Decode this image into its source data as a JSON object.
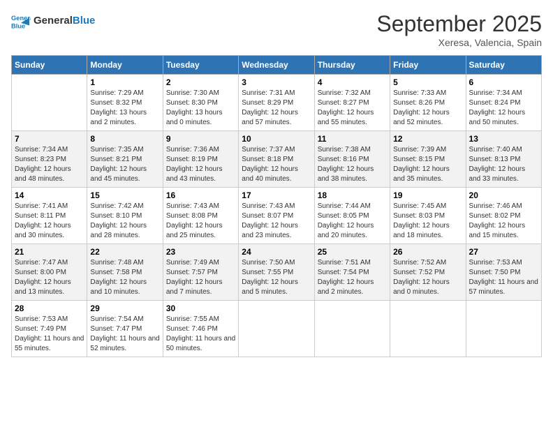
{
  "header": {
    "logo_line1": "General",
    "logo_line2": "Blue",
    "month_title": "September 2025",
    "subtitle": "Xeresa, Valencia, Spain"
  },
  "days_of_week": [
    "Sunday",
    "Monday",
    "Tuesday",
    "Wednesday",
    "Thursday",
    "Friday",
    "Saturday"
  ],
  "weeks": [
    [
      {
        "day": "",
        "sunrise": "",
        "sunset": "",
        "daylight": ""
      },
      {
        "day": "1",
        "sunrise": "Sunrise: 7:29 AM",
        "sunset": "Sunset: 8:32 PM",
        "daylight": "Daylight: 13 hours and 2 minutes."
      },
      {
        "day": "2",
        "sunrise": "Sunrise: 7:30 AM",
        "sunset": "Sunset: 8:30 PM",
        "daylight": "Daylight: 13 hours and 0 minutes."
      },
      {
        "day": "3",
        "sunrise": "Sunrise: 7:31 AM",
        "sunset": "Sunset: 8:29 PM",
        "daylight": "Daylight: 12 hours and 57 minutes."
      },
      {
        "day": "4",
        "sunrise": "Sunrise: 7:32 AM",
        "sunset": "Sunset: 8:27 PM",
        "daylight": "Daylight: 12 hours and 55 minutes."
      },
      {
        "day": "5",
        "sunrise": "Sunrise: 7:33 AM",
        "sunset": "Sunset: 8:26 PM",
        "daylight": "Daylight: 12 hours and 52 minutes."
      },
      {
        "day": "6",
        "sunrise": "Sunrise: 7:34 AM",
        "sunset": "Sunset: 8:24 PM",
        "daylight": "Daylight: 12 hours and 50 minutes."
      }
    ],
    [
      {
        "day": "7",
        "sunrise": "Sunrise: 7:34 AM",
        "sunset": "Sunset: 8:23 PM",
        "daylight": "Daylight: 12 hours and 48 minutes."
      },
      {
        "day": "8",
        "sunrise": "Sunrise: 7:35 AM",
        "sunset": "Sunset: 8:21 PM",
        "daylight": "Daylight: 12 hours and 45 minutes."
      },
      {
        "day": "9",
        "sunrise": "Sunrise: 7:36 AM",
        "sunset": "Sunset: 8:19 PM",
        "daylight": "Daylight: 12 hours and 43 minutes."
      },
      {
        "day": "10",
        "sunrise": "Sunrise: 7:37 AM",
        "sunset": "Sunset: 8:18 PM",
        "daylight": "Daylight: 12 hours and 40 minutes."
      },
      {
        "day": "11",
        "sunrise": "Sunrise: 7:38 AM",
        "sunset": "Sunset: 8:16 PM",
        "daylight": "Daylight: 12 hours and 38 minutes."
      },
      {
        "day": "12",
        "sunrise": "Sunrise: 7:39 AM",
        "sunset": "Sunset: 8:15 PM",
        "daylight": "Daylight: 12 hours and 35 minutes."
      },
      {
        "day": "13",
        "sunrise": "Sunrise: 7:40 AM",
        "sunset": "Sunset: 8:13 PM",
        "daylight": "Daylight: 12 hours and 33 minutes."
      }
    ],
    [
      {
        "day": "14",
        "sunrise": "Sunrise: 7:41 AM",
        "sunset": "Sunset: 8:11 PM",
        "daylight": "Daylight: 12 hours and 30 minutes."
      },
      {
        "day": "15",
        "sunrise": "Sunrise: 7:42 AM",
        "sunset": "Sunset: 8:10 PM",
        "daylight": "Daylight: 12 hours and 28 minutes."
      },
      {
        "day": "16",
        "sunrise": "Sunrise: 7:43 AM",
        "sunset": "Sunset: 8:08 PM",
        "daylight": "Daylight: 12 hours and 25 minutes."
      },
      {
        "day": "17",
        "sunrise": "Sunrise: 7:43 AM",
        "sunset": "Sunset: 8:07 PM",
        "daylight": "Daylight: 12 hours and 23 minutes."
      },
      {
        "day": "18",
        "sunrise": "Sunrise: 7:44 AM",
        "sunset": "Sunset: 8:05 PM",
        "daylight": "Daylight: 12 hours and 20 minutes."
      },
      {
        "day": "19",
        "sunrise": "Sunrise: 7:45 AM",
        "sunset": "Sunset: 8:03 PM",
        "daylight": "Daylight: 12 hours and 18 minutes."
      },
      {
        "day": "20",
        "sunrise": "Sunrise: 7:46 AM",
        "sunset": "Sunset: 8:02 PM",
        "daylight": "Daylight: 12 hours and 15 minutes."
      }
    ],
    [
      {
        "day": "21",
        "sunrise": "Sunrise: 7:47 AM",
        "sunset": "Sunset: 8:00 PM",
        "daylight": "Daylight: 12 hours and 13 minutes."
      },
      {
        "day": "22",
        "sunrise": "Sunrise: 7:48 AM",
        "sunset": "Sunset: 7:58 PM",
        "daylight": "Daylight: 12 hours and 10 minutes."
      },
      {
        "day": "23",
        "sunrise": "Sunrise: 7:49 AM",
        "sunset": "Sunset: 7:57 PM",
        "daylight": "Daylight: 12 hours and 7 minutes."
      },
      {
        "day": "24",
        "sunrise": "Sunrise: 7:50 AM",
        "sunset": "Sunset: 7:55 PM",
        "daylight": "Daylight: 12 hours and 5 minutes."
      },
      {
        "day": "25",
        "sunrise": "Sunrise: 7:51 AM",
        "sunset": "Sunset: 7:54 PM",
        "daylight": "Daylight: 12 hours and 2 minutes."
      },
      {
        "day": "26",
        "sunrise": "Sunrise: 7:52 AM",
        "sunset": "Sunset: 7:52 PM",
        "daylight": "Daylight: 12 hours and 0 minutes."
      },
      {
        "day": "27",
        "sunrise": "Sunrise: 7:53 AM",
        "sunset": "Sunset: 7:50 PM",
        "daylight": "Daylight: 11 hours and 57 minutes."
      }
    ],
    [
      {
        "day": "28",
        "sunrise": "Sunrise: 7:53 AM",
        "sunset": "Sunset: 7:49 PM",
        "daylight": "Daylight: 11 hours and 55 minutes."
      },
      {
        "day": "29",
        "sunrise": "Sunrise: 7:54 AM",
        "sunset": "Sunset: 7:47 PM",
        "daylight": "Daylight: 11 hours and 52 minutes."
      },
      {
        "day": "30",
        "sunrise": "Sunrise: 7:55 AM",
        "sunset": "Sunset: 7:46 PM",
        "daylight": "Daylight: 11 hours and 50 minutes."
      },
      {
        "day": "",
        "sunrise": "",
        "sunset": "",
        "daylight": ""
      },
      {
        "day": "",
        "sunrise": "",
        "sunset": "",
        "daylight": ""
      },
      {
        "day": "",
        "sunrise": "",
        "sunset": "",
        "daylight": ""
      },
      {
        "day": "",
        "sunrise": "",
        "sunset": "",
        "daylight": ""
      }
    ]
  ]
}
